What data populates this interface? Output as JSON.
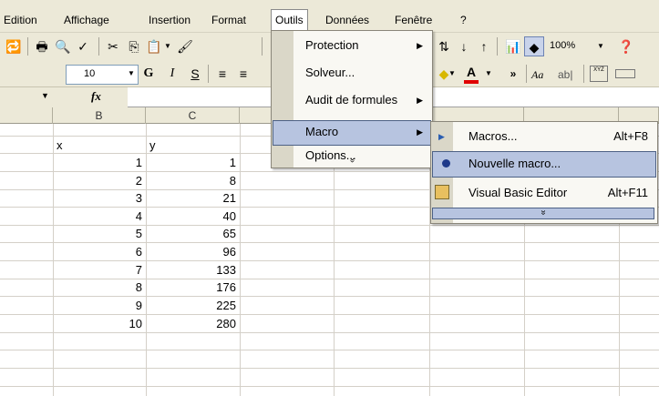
{
  "menubar": {
    "items": [
      "Edition",
      "Affichage",
      "Insertion",
      "Format",
      "Outils",
      "Données",
      "Fenêtre",
      "?"
    ]
  },
  "toolbar": {
    "font_size": "10",
    "zoom": "100%",
    "bold": "G",
    "italic": "I",
    "underline": "S",
    "font_color_letter": "A",
    "style_sample": "Aa",
    "ab_sample": "ab|",
    "xyz_sample": "XYZ"
  },
  "formula_bar": {
    "fx": "fx"
  },
  "grid": {
    "col_headers": [
      "B",
      "C"
    ],
    "x_header": "x",
    "y_header": "y",
    "rows": [
      {
        "x": "1",
        "y": "1"
      },
      {
        "x": "2",
        "y": "8"
      },
      {
        "x": "3",
        "y": "21"
      },
      {
        "x": "4",
        "y": "40"
      },
      {
        "x": "5",
        "y": "65"
      },
      {
        "x": "6",
        "y": "96"
      },
      {
        "x": "7",
        "y": "133"
      },
      {
        "x": "8",
        "y": "176"
      },
      {
        "x": "9",
        "y": "225"
      },
      {
        "x": "10",
        "y": "280"
      }
    ]
  },
  "outils_menu": {
    "items": [
      {
        "label": "Protection",
        "has_submenu": true
      },
      {
        "label": "Solveur...",
        "has_submenu": false
      },
      {
        "label": "Audit de formules",
        "has_submenu": true
      },
      {
        "label": "Macro",
        "has_submenu": true,
        "highlighted": true
      },
      {
        "label": "Options...",
        "has_submenu": false
      }
    ],
    "more": "»"
  },
  "macro_submenu": {
    "items": [
      {
        "label": "Macros...",
        "shortcut": "Alt+F8",
        "icon": "play-icon"
      },
      {
        "label": "Nouvelle macro...",
        "shortcut": "",
        "icon": "record-dot-icon",
        "highlighted": true
      },
      {
        "label": "Visual Basic Editor",
        "shortcut": "Alt+F11",
        "icon": "vbe-icon"
      }
    ],
    "more": "»"
  },
  "colors": {
    "chrome": "#ece9d8",
    "highlight": "#b7c4e0",
    "highlight_border": "#4d6185",
    "record_dot": "#1f3a8a",
    "font_color_bar": "#e00000"
  }
}
